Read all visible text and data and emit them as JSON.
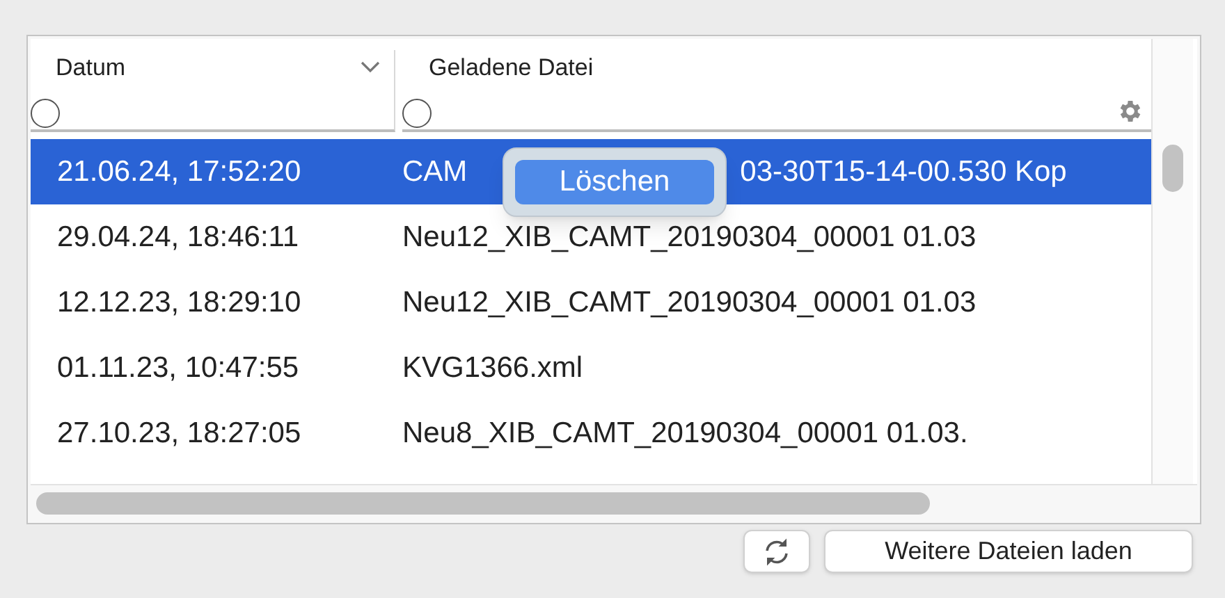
{
  "table": {
    "columns": [
      {
        "label": "Datum",
        "sorted": true,
        "filter_checked": false
      },
      {
        "label": "Geladene Datei",
        "sorted": false,
        "filter_checked": false
      }
    ],
    "rows": [
      {
        "date": "21.06.24, 17:52:20",
        "file_parts": [
          "CAM",
          "03-30T15-14-00.530 Kop"
        ],
        "selected": true
      },
      {
        "date": "29.04.24, 18:46:11",
        "file_parts": [
          "Neu12_XIB_CAMT_20190304_00001 01.03"
        ],
        "selected": false
      },
      {
        "date": "12.12.23, 18:29:10",
        "file_parts": [
          "Neu12_XIB_CAMT_20190304_00001 01.03"
        ],
        "selected": false
      },
      {
        "date": "01.11.23, 10:47:55",
        "file_parts": [
          "KVG1366.xml"
        ],
        "selected": false
      },
      {
        "date": "27.10.23, 18:27:05",
        "file_parts": [
          "Neu8_XIB_CAMT_20190304_00001 01.03."
        ],
        "selected": false
      }
    ]
  },
  "context_menu": {
    "items": [
      "Löschen"
    ]
  },
  "buttons": {
    "load_more": "Weitere Dateien laden"
  }
}
